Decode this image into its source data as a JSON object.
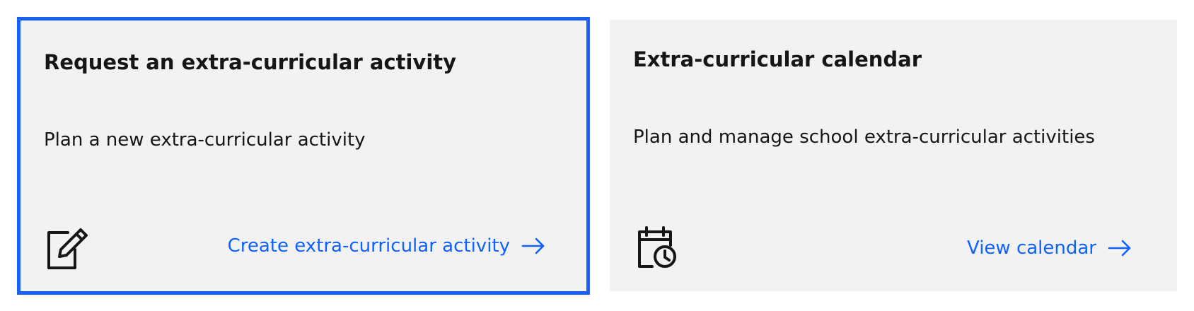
{
  "cards": [
    {
      "title": "Request an extra-curricular activity",
      "description": "Plan a new extra-curricular activity",
      "icon": "edit-icon",
      "link_label": "Create extra-curricular activity",
      "focused": true
    },
    {
      "title": "Extra-curricular calendar",
      "description": "Plan and manage school extra-curricular activities",
      "icon": "calendar-clock-icon",
      "link_label": "View calendar",
      "focused": false
    }
  ],
  "colors": {
    "card_background": "#f2f2f2",
    "focus_border": "#1760f7",
    "link": "#0f62fe",
    "text": "#161616"
  }
}
